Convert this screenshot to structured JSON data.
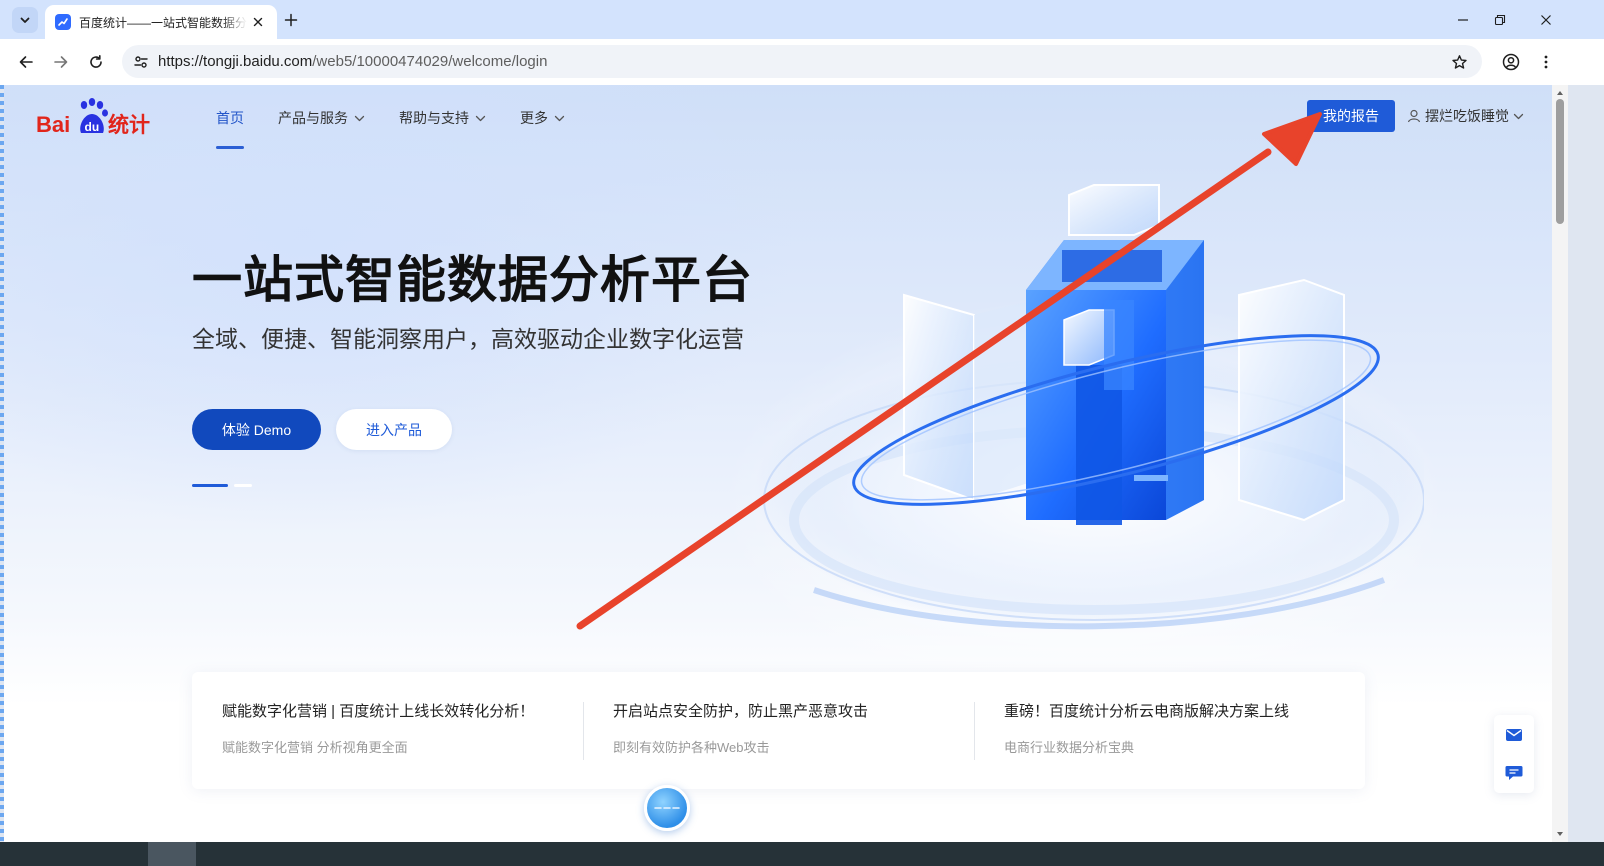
{
  "browser": {
    "tab": {
      "title": "百度统计——一站式智能数据分析平台"
    },
    "url": {
      "host": "https://tongji.baidu.com",
      "path": "/web5/10000474029/welcome/login"
    }
  },
  "header": {
    "logo": {
      "text_en": "Bai",
      "text_paw": "du",
      "text_cn": "统计"
    },
    "nav": [
      {
        "label": "首页",
        "active": true
      },
      {
        "label": "产品与服务"
      },
      {
        "label": "帮助与支持"
      },
      {
        "label": "更多"
      }
    ],
    "report_button": "我的报告",
    "user_name": "摆烂吃饭睡觉"
  },
  "hero": {
    "title": "一站式智能数据分析平台",
    "subtitle": "全域、便捷、智能洞察用户，高效驱动企业数字化运营",
    "demo_button": "体验 Demo",
    "enter_button": "进入产品",
    "carousel": {
      "count": 2,
      "active_index": 0
    }
  },
  "news": [
    {
      "title": "赋能数字化营销 | 百度统计上线长效转化分析！",
      "subtitle": "赋能数字化营销 分析视角更全面"
    },
    {
      "title": "开启站点安全防护，防止黑产恶意攻击",
      "subtitle": "即刻有效防护各种Web攻击"
    },
    {
      "title": "重磅！百度统计分析云电商版解决方案上线",
      "subtitle": "电商行业数据分析宝典"
    }
  ],
  "colors": {
    "brand_red": "#e1251b",
    "brand_blue": "#2932e1",
    "primary": "#1f5bd8",
    "demo_button": "#1149bd",
    "annotation_arrow": "#e8432b"
  },
  "annotation": {
    "type": "arrow",
    "target": "report_button"
  }
}
